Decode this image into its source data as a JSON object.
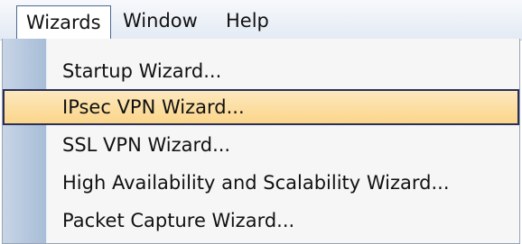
{
  "menubar": {
    "items": [
      {
        "label": "Wizards",
        "active": true
      },
      {
        "label": "Window",
        "active": false
      },
      {
        "label": "Help",
        "active": false
      }
    ]
  },
  "dropdown": {
    "items": [
      {
        "label": "Startup Wizard..."
      },
      {
        "label": "IPsec VPN Wizard...",
        "highlighted": true
      },
      {
        "label": "SSL VPN Wizard..."
      },
      {
        "label": "High Availability and Scalability Wizard..."
      },
      {
        "label": "Packet Capture Wizard..."
      }
    ]
  },
  "colors": {
    "highlight_fill": "#fbd58a",
    "highlight_border": "#2a2f58",
    "gutter": "#b4c6dd"
  }
}
